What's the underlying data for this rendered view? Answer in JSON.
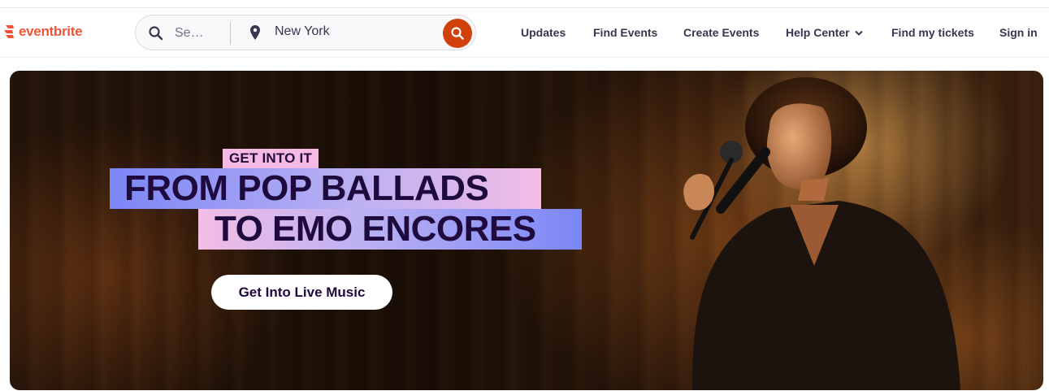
{
  "header": {
    "logo_text": "eventbrite",
    "brand_color": "#f05537",
    "search": {
      "placeholder": "Search events",
      "value": "Sea…",
      "location": "New York",
      "button_color": "#d1410c"
    },
    "nav": [
      {
        "label": "Updates"
      },
      {
        "label": "Find Events"
      },
      {
        "label": "Create Events"
      },
      {
        "label": "Help Center",
        "icon": "chevron-down-icon"
      },
      {
        "label": "Find my tickets"
      },
      {
        "label": "Sign in"
      }
    ]
  },
  "hero": {
    "eyebrow": "GET INTO IT",
    "headline_line1": "FROM POP BALLADS",
    "headline_line2": "TO EMO ENCORES",
    "cta_label": "Get Into Live Music",
    "accent_pink": "#f5b9e4",
    "accent_blue": "#7b86f6"
  }
}
